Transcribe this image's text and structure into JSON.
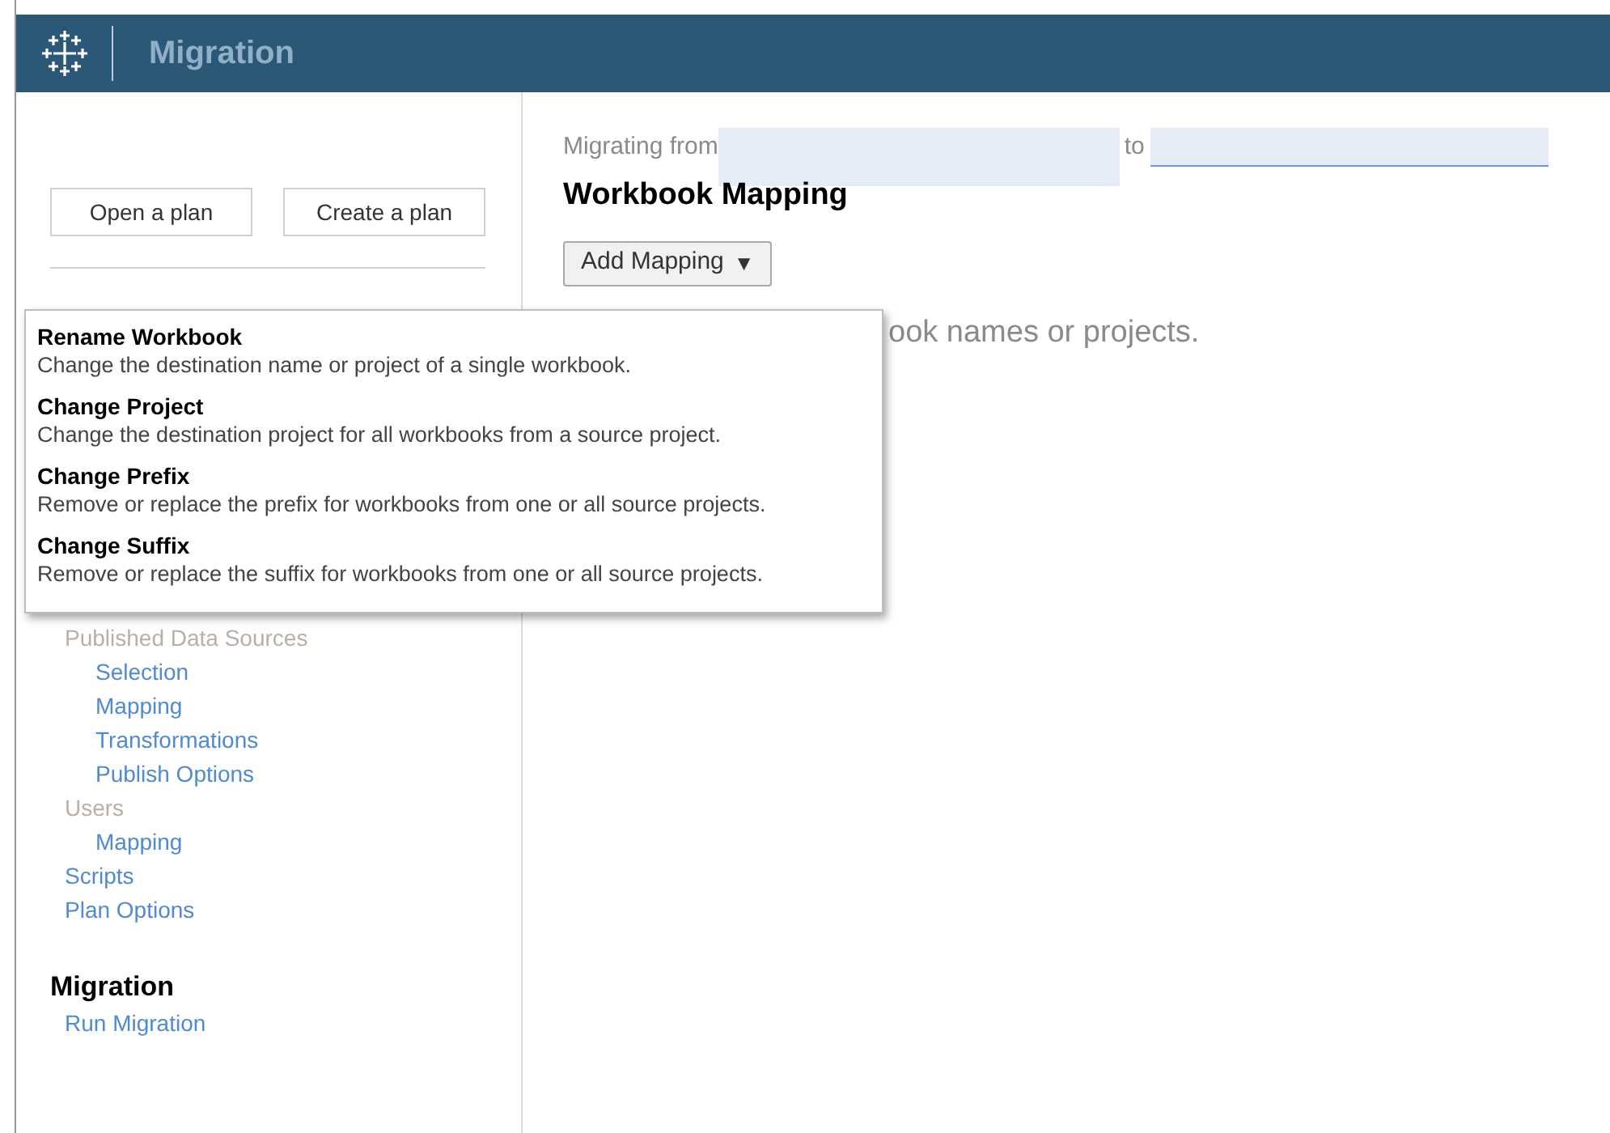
{
  "header": {
    "title": "Migration"
  },
  "sidebar": {
    "buttons": [
      "Open a plan",
      "Create a plan"
    ],
    "tree": [
      {
        "label": "Published Data Sources",
        "kind": "section",
        "children": [
          {
            "label": "Selection",
            "kind": "link"
          },
          {
            "label": "Mapping",
            "kind": "link"
          },
          {
            "label": "Transformations",
            "kind": "link"
          },
          {
            "label": "Publish Options",
            "kind": "link"
          }
        ]
      },
      {
        "label": "Users",
        "kind": "section",
        "children": [
          {
            "label": "Mapping",
            "kind": "link"
          }
        ]
      },
      {
        "label": "Scripts",
        "kind": "link"
      },
      {
        "label": "Plan Options",
        "kind": "link"
      }
    ],
    "migration": {
      "heading": "Migration",
      "items": [
        {
          "label": "Run Migration",
          "kind": "link"
        }
      ]
    }
  },
  "main": {
    "from_label": "Migrating from",
    "to_label": "to",
    "heading": "Workbook Mapping",
    "add_button": "Add Mapping",
    "caret": "▼",
    "hint": "ook names or projects."
  },
  "menu": [
    {
      "title": "Rename Workbook",
      "description": "Change the destination name or project of a single workbook."
    },
    {
      "title": "Change Project",
      "description": "Change the destination project for all workbooks from a source project."
    },
    {
      "title": "Change Prefix",
      "description": "Remove or replace the prefix for workbooks from one or all source projects."
    },
    {
      "title": "Change Suffix",
      "description": "Remove or replace the suffix for workbooks from one or all source projects."
    }
  ]
}
